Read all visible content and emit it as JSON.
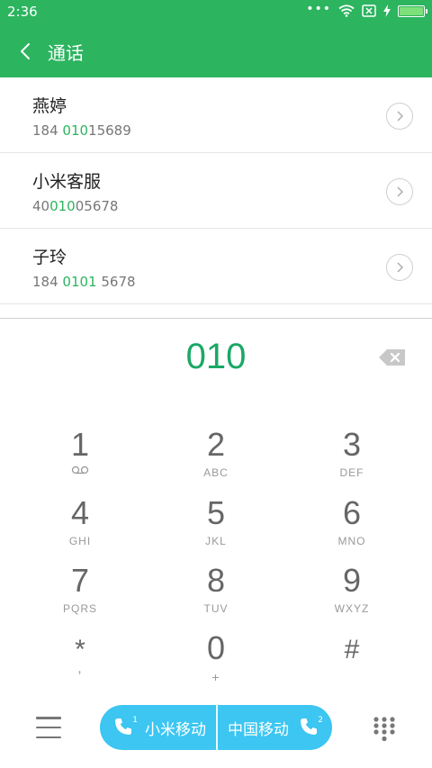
{
  "status_bar": {
    "time": "2:36",
    "dots": "•••",
    "battery_level": 1.0
  },
  "title_bar": {
    "title": "通话"
  },
  "contacts": [
    {
      "name": "燕婷",
      "num_pre": "184 ",
      "num_match": "010",
      "num_post": "15689"
    },
    {
      "name": "小米客服",
      "num_pre": "40",
      "num_match": "010",
      "num_post": "05678"
    },
    {
      "name": "子玲",
      "num_pre": "184 ",
      "num_match": "0101",
      "num_post": " 5678"
    }
  ],
  "dialer": {
    "entered_number": "010"
  },
  "keypad": [
    {
      "digit": "1",
      "letters": "",
      "icon": "voicemail-icon"
    },
    {
      "digit": "2",
      "letters": "ABC"
    },
    {
      "digit": "3",
      "letters": "DEF"
    },
    {
      "digit": "4",
      "letters": "GHI"
    },
    {
      "digit": "5",
      "letters": "JKL"
    },
    {
      "digit": "6",
      "letters": "MNO"
    },
    {
      "digit": "7",
      "letters": "PQRS"
    },
    {
      "digit": "8",
      "letters": "TUV"
    },
    {
      "digit": "9",
      "letters": "WXYZ"
    },
    {
      "digit": "*",
      "letters": ","
    },
    {
      "digit": "0",
      "letters": "+"
    },
    {
      "digit": "#",
      "letters": ""
    }
  ],
  "call_buttons": {
    "sim1_label": "小米移动",
    "sim1_index": "1",
    "sim2_label": "中国移动",
    "sim2_index": "2"
  },
  "colors": {
    "brand_green": "#2cb45f",
    "match_green": "#1aa866",
    "call_blue": "#3cc6f1"
  }
}
